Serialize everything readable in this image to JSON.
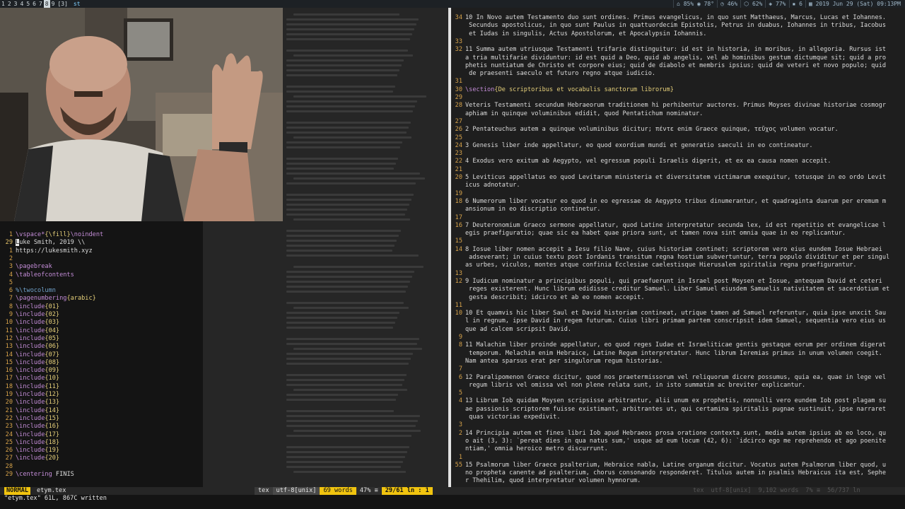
{
  "topbar": {
    "workspaces": [
      "1",
      "2",
      "3",
      "4",
      "5",
      "6",
      "7",
      "8",
      "9",
      "[3]"
    ],
    "active_workspace": "8",
    "window_title": "st",
    "status": [
      "⌂ 85% ◉ 78°",
      "◷ 46%",
      "⬡ 62%",
      "◈ 77%",
      "▪ 6",
      "▦ 2019 Jun 29 (Sat) 09:13PM"
    ]
  },
  "left_editor": {
    "lines": [
      {
        "n": "1",
        "segs": [
          [
            "kw",
            "\\vspace*"
          ],
          [
            "br",
            "{\\fill}"
          ],
          [
            "kw",
            "\\noindent"
          ]
        ]
      },
      {
        "n": "29",
        "cur": true,
        "segs": [
          [
            "cursor",
            "L"
          ],
          [
            "tx",
            "uke Smith, 2019 \\\\"
          ]
        ]
      },
      {
        "n": "1",
        "segs": [
          [
            "tx",
            "https://lukesmith.xyz"
          ]
        ]
      },
      {
        "n": "2",
        "segs": []
      },
      {
        "n": "3",
        "segs": [
          [
            "kw",
            "\\pagebreak"
          ]
        ]
      },
      {
        "n": "4",
        "segs": [
          [
            "kw",
            "\\tableofcontents"
          ]
        ]
      },
      {
        "n": "5",
        "segs": []
      },
      {
        "n": "6",
        "segs": [
          [
            "cm",
            "%\\twocolumn"
          ]
        ]
      },
      {
        "n": "7",
        "segs": [
          [
            "kw",
            "\\pagenumbering"
          ],
          [
            "br",
            "{arabic}"
          ]
        ]
      },
      {
        "n": "8",
        "segs": [
          [
            "kw",
            "\\include"
          ],
          [
            "br",
            "{01}"
          ]
        ]
      },
      {
        "n": "9",
        "segs": [
          [
            "kw",
            "\\include"
          ],
          [
            "br",
            "{02}"
          ]
        ]
      },
      {
        "n": "10",
        "segs": [
          [
            "kw",
            "\\include"
          ],
          [
            "br",
            "{03}"
          ]
        ]
      },
      {
        "n": "11",
        "segs": [
          [
            "kw",
            "\\include"
          ],
          [
            "br",
            "{04}"
          ]
        ]
      },
      {
        "n": "12",
        "segs": [
          [
            "kw",
            "\\include"
          ],
          [
            "br",
            "{05}"
          ]
        ]
      },
      {
        "n": "13",
        "segs": [
          [
            "kw",
            "\\include"
          ],
          [
            "br",
            "{06}"
          ]
        ]
      },
      {
        "n": "14",
        "segs": [
          [
            "kw",
            "\\include"
          ],
          [
            "br",
            "{07}"
          ]
        ]
      },
      {
        "n": "15",
        "segs": [
          [
            "kw",
            "\\include"
          ],
          [
            "br",
            "{08}"
          ]
        ]
      },
      {
        "n": "16",
        "segs": [
          [
            "kw",
            "\\include"
          ],
          [
            "br",
            "{09}"
          ]
        ]
      },
      {
        "n": "17",
        "segs": [
          [
            "kw",
            "\\include"
          ],
          [
            "br",
            "{10}"
          ]
        ]
      },
      {
        "n": "18",
        "segs": [
          [
            "kw",
            "\\include"
          ],
          [
            "br",
            "{11}"
          ]
        ]
      },
      {
        "n": "19",
        "segs": [
          [
            "kw",
            "\\include"
          ],
          [
            "br",
            "{12}"
          ]
        ]
      },
      {
        "n": "20",
        "segs": [
          [
            "kw",
            "\\include"
          ],
          [
            "br",
            "{13}"
          ]
        ]
      },
      {
        "n": "21",
        "segs": [
          [
            "kw",
            "\\include"
          ],
          [
            "br",
            "{14}"
          ]
        ]
      },
      {
        "n": "22",
        "segs": [
          [
            "kw",
            "\\include"
          ],
          [
            "br",
            "{15}"
          ]
        ]
      },
      {
        "n": "23",
        "segs": [
          [
            "kw",
            "\\include"
          ],
          [
            "br",
            "{16}"
          ]
        ]
      },
      {
        "n": "24",
        "segs": [
          [
            "kw",
            "\\include"
          ],
          [
            "br",
            "{17}"
          ]
        ]
      },
      {
        "n": "25",
        "segs": [
          [
            "kw",
            "\\include"
          ],
          [
            "br",
            "{18}"
          ]
        ]
      },
      {
        "n": "26",
        "segs": [
          [
            "kw",
            "\\include"
          ],
          [
            "br",
            "{19}"
          ]
        ]
      },
      {
        "n": "27",
        "segs": [
          [
            "kw",
            "\\include"
          ],
          [
            "br",
            "{20}"
          ]
        ]
      },
      {
        "n": "28",
        "segs": []
      },
      {
        "n": "29",
        "segs": [
          [
            "kw",
            "\\centering"
          ],
          [
            "tx",
            " FINIS"
          ]
        ]
      }
    ]
  },
  "right_editor": {
    "lines": [
      {
        "n": "34",
        "t": "10 In Novo autem Testamento duo sunt ordines. Primus evangelicus, in quo sunt Matthaeus, Marcus, Lucas et Iohannes."
      },
      {
        "n": "",
        "t": " Secundus apostolicus, in quo sunt Paulus in quattuordecim Epistolis, Petrus in duabus, Iohannes in tribus, Iacobus"
      },
      {
        "n": "",
        "t": " et Iudas in singulis, Actus Apostolorum, et Apocalypsin Iohannis."
      },
      {
        "n": "33",
        "t": ""
      },
      {
        "n": "32",
        "t": "11 Summa autem utriusque Testamenti trifarie distinguitur: id est in historia, in moribus, in allegoria. Rursus ist"
      },
      {
        "n": "",
        "t": "a tria multifarie dividuntur: id est quid a Deo, quid ab angelis, vel ab hominibus gestum dictumque sit; quid a pro"
      },
      {
        "n": "",
        "t": "phetis nuntiatum de Christo et corpore eius; quid de diabolo et membris ipsius; quid de veteri et novo populo; quid"
      },
      {
        "n": "",
        "t": " de praesenti saeculo et futuro regno atque iudicio."
      },
      {
        "n": "31",
        "t": ""
      },
      {
        "n": "30",
        "t": "\\section{De scriptoribus et vocabulis sanctorum librorum}"
      },
      {
        "n": "29",
        "t": ""
      },
      {
        "n": "28",
        "t": "Veteris Testamenti secundum Hebraeorum traditionem hi perhibentur auctores. Primus Moyses divinae historiae cosmogr"
      },
      {
        "n": "",
        "t": "aphiam in quinque voluminibus edidit, quod Pentatichum nominatur."
      },
      {
        "n": "27",
        "t": ""
      },
      {
        "n": "26",
        "t": "2 Pentateuchus autem a quinque voluminibus dicitur; πέντε enim Graece quinque, τεῦχος volumen vocatur."
      },
      {
        "n": "25",
        "t": ""
      },
      {
        "n": "24",
        "t": "3 Genesis liber inde appellatur, eo quod exordium mundi et generatio saeculi in eo contineatur."
      },
      {
        "n": "23",
        "t": ""
      },
      {
        "n": "22",
        "t": "4 Exodus vero exitum ab Aegypto, vel egressum populi Israelis digerit, et ex ea causa nomen accepit."
      },
      {
        "n": "21",
        "t": ""
      },
      {
        "n": "20",
        "t": "5 Leviticus appellatus eo quod Levitarum ministeria et diversitatem victimarum exequitur, totusque in eo ordo Levit"
      },
      {
        "n": "",
        "t": "icus adnotatur."
      },
      {
        "n": "19",
        "t": ""
      },
      {
        "n": "18",
        "t": "6 Numerorum liber vocatur eo quod in eo egressae de Aegypto tribus dinumerantur, et quadraginta duarum per eremum m"
      },
      {
        "n": "",
        "t": "ansionum in eo discriptio continetur."
      },
      {
        "n": "17",
        "t": ""
      },
      {
        "n": "16",
        "t": "7 Deuteronomium Graeco sermone appellatur, quod Latine interpretatur secunda lex, id est repetitio et evangelicae l"
      },
      {
        "n": "",
        "t": "egis praefiguratio; quae sic ea habet quae priora sunt, ut tamen nova sint omnia quae in eo replicantur."
      },
      {
        "n": "15",
        "t": ""
      },
      {
        "n": "14",
        "t": "8 Iosue liber nomen accepit a Iesu filio Nave, cuius historiam continet; scriptorem vero eius eundem Iosue Hebraei"
      },
      {
        "n": "",
        "t": " adseverant; in cuius textu post Iordanis transitum regna hostium subvertuntur, terra populo dividitur et per singul"
      },
      {
        "n": "",
        "t": "as urbes, viculos, montes atque confinia Ecclesiae caelestisque Hierusalem spiritalia regna praefigurantur."
      },
      {
        "n": "13",
        "t": ""
      },
      {
        "n": "12",
        "t": "9 Iudicum nominatur a principibus populi, qui praefuerunt in Israel post Moysen et Iosue, antequam David et ceteri"
      },
      {
        "n": "",
        "t": " reges existerent. Hunc librum edidisse creditur Samuel. Liber Samuel eiusdem Samuelis nativitatem et sacerdotium et"
      },
      {
        "n": "",
        "t": " gesta describit; idcirco et ab eo nomen accepit."
      },
      {
        "n": "11",
        "t": ""
      },
      {
        "n": "10",
        "t": "10 Et quamvis hic liber Saul et David historiam contineat, utrique tamen ad Samuel referuntur, quia ipse unxcit Sau"
      },
      {
        "n": "",
        "t": "l in regnum, ipse David in regem futurum. Cuius libri primam partem conscripsit idem Samuel, sequentia vero eius us"
      },
      {
        "n": "",
        "t": "que ad calcem scripsit David."
      },
      {
        "n": "9",
        "t": ""
      },
      {
        "n": "8",
        "t": "11 Malachim liber proinde appellatur, eo quod reges Iudae et Israeliticae gentis gestaque eorum per ordinem digerat"
      },
      {
        "n": "",
        "t": " temporum. Melachim enim Hebraice, Latine Regum interpretatur. Hunc librum Ieremias primus in unum volumen coegit."
      },
      {
        "n": "",
        "t": "Nam antea sparsus erat per singulorum regum historias."
      },
      {
        "n": "7",
        "t": ""
      },
      {
        "n": "6",
        "t": "12 Paralipomenon Graece dicitur, quod nos praetermissorum vel reliquorum dicere possumus, quia ea, quae in lege vel"
      },
      {
        "n": "",
        "t": " regum libris vel omissa vel non plene relata sunt, in isto summatim ac breviter explicantur."
      },
      {
        "n": "5",
        "t": ""
      },
      {
        "n": "4",
        "t": "13 Librum Iob quidam Moysen scripsisse arbitrantur, alii unum ex prophetis, nonnulli vero eundem Iob post plagam su"
      },
      {
        "n": "",
        "t": "ae passionis scriptorem fuisse existimant, arbitrantes ut, qui certamina spiritalis pugnae sustinuit, ipse narraret"
      },
      {
        "n": "",
        "t": " quas victorias expedivit."
      },
      {
        "n": "3",
        "t": ""
      },
      {
        "n": "2",
        "t": "14 Principia autem et fines libri Iob apud Hebraeos prosa oratione contexta sunt, media autem ipsius ab eo loco, qu"
      },
      {
        "n": "",
        "t": "o ait (3, 3): `pereat dies in qua natus sum,' usque ad eum locum (42, 6): `idcirco ego me reprehendo et ago poenite"
      },
      {
        "n": "",
        "t": "ntiam,' omnia heroico metro discurrunt."
      },
      {
        "n": "1",
        "t": ""
      },
      {
        "n": "55",
        "t": "15 Psalmorum liber Graece psalterium, Hebraice nabla, Latine organum dicitur. Vocatus autem Psalmorum liber quod, u"
      },
      {
        "n": "",
        "t": "no propheta canente ad psalterium, chorus consonando responderet. Titulus autem in psalmis Hebraicus ita est, Sephe"
      },
      {
        "n": "",
        "t": "r Thehilim, quod interpretatur volumen hymnorum."
      }
    ]
  },
  "statusline": {
    "mode": "NORMAL",
    "file": "etym.tex",
    "filetype": "tex",
    "encoding": "utf-8[unix]",
    "words": "69 words",
    "percent": "47% ≡",
    "position": "29/61 ln :  1",
    "ghost": [
      "tex",
      "utf-8[unix]",
      "9,102 words",
      "7% ≡",
      "56/737 ln"
    ]
  },
  "cmdline": "\"etym.tex\" 61L, 867C written"
}
